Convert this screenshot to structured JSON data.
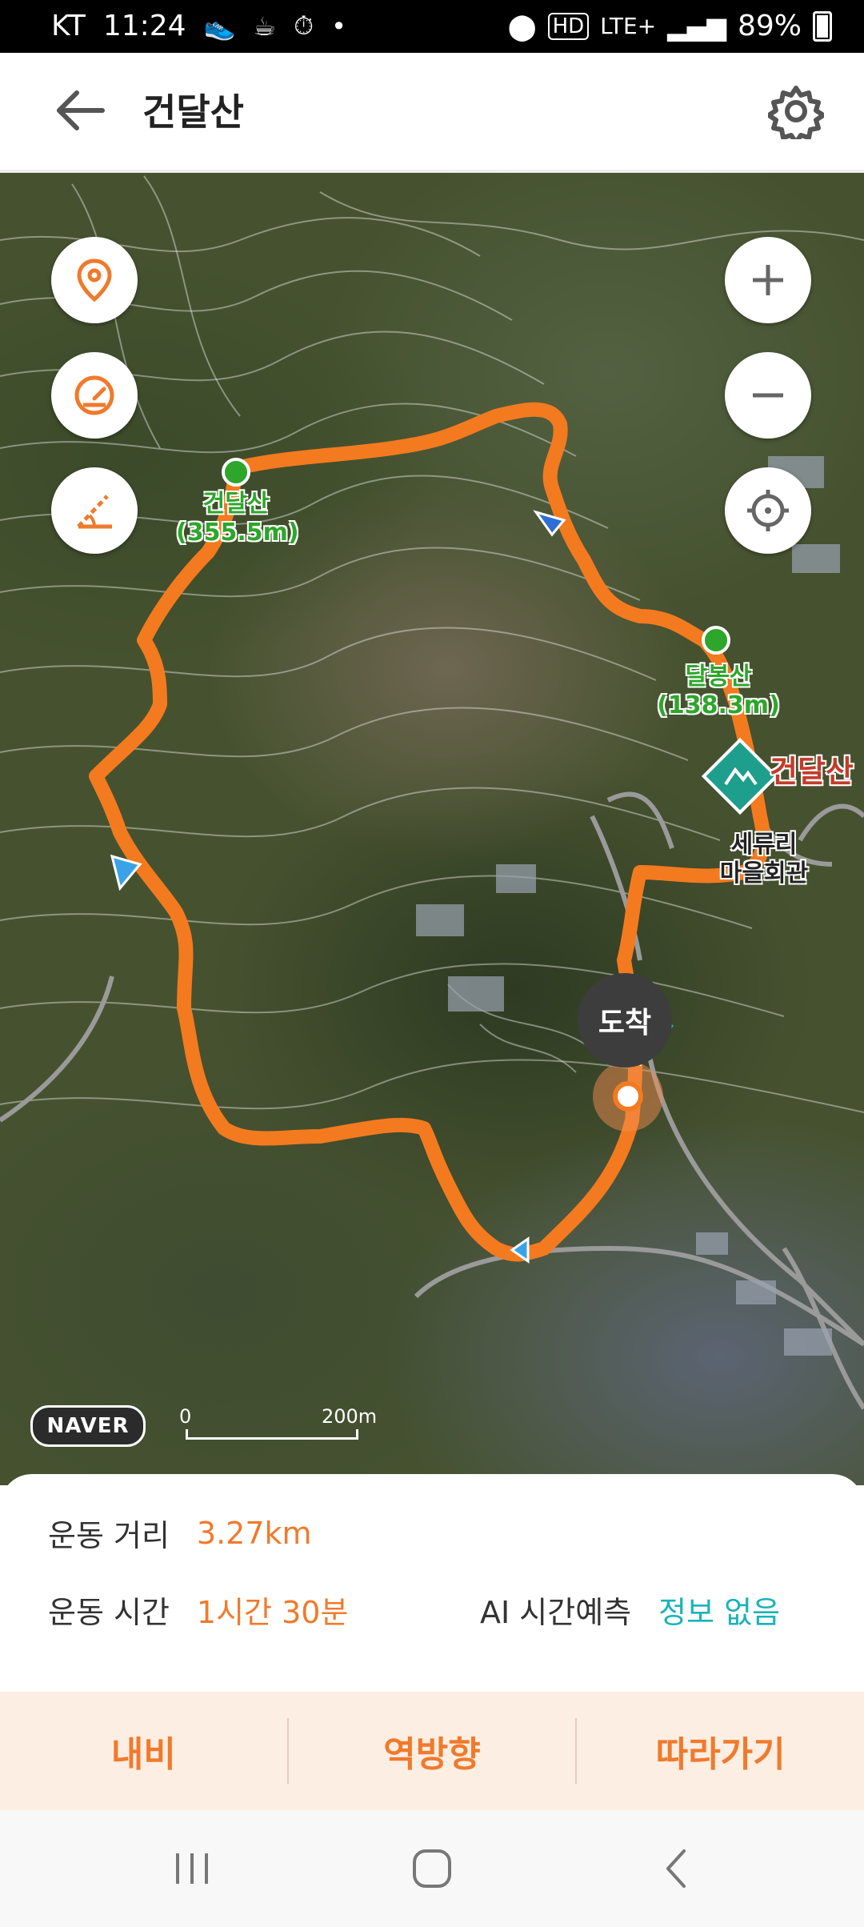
{
  "status_bar": {
    "carrier": "KT",
    "time": "11:24",
    "network": "LTE+",
    "hd": "HD",
    "battery": "89%"
  },
  "header": {
    "title": "건달산",
    "back_icon": "arrow-left-icon",
    "settings_icon": "gear-icon"
  },
  "map": {
    "controls_left": [
      "location-pin-icon",
      "speedometer-icon",
      "measure-angle-icon"
    ],
    "controls_right": [
      "zoom-in-icon",
      "zoom-out-icon",
      "current-location-icon"
    ],
    "peaks": [
      {
        "name": "건달산",
        "elevation": "(355.5m)"
      },
      {
        "name": "달봉산",
        "elevation": "(138.3m)"
      }
    ],
    "mountain_label": "건달산",
    "place_label_line1": "세류리",
    "place_label_line2": "마을회관",
    "arrive_label": "도착",
    "logo": "NAVER",
    "scale_start": "0",
    "scale_end": "200m",
    "route_color": "#f47a1f"
  },
  "info": {
    "distance_label": "운동 거리",
    "distance_value": "3.27km",
    "time_label": "운동 시간",
    "time_value": "1시간 30분",
    "ai_label": "AI 시간예측",
    "ai_value": "정보 없음"
  },
  "actions": {
    "navi": "내비",
    "reverse": "역방향",
    "follow": "따라가기"
  },
  "system_nav": [
    "recent-apps-icon",
    "home-icon",
    "back-icon"
  ],
  "colors": {
    "accent": "#f07a2c",
    "teal": "#1bb3b8",
    "action_bg": "#fdeee3"
  }
}
